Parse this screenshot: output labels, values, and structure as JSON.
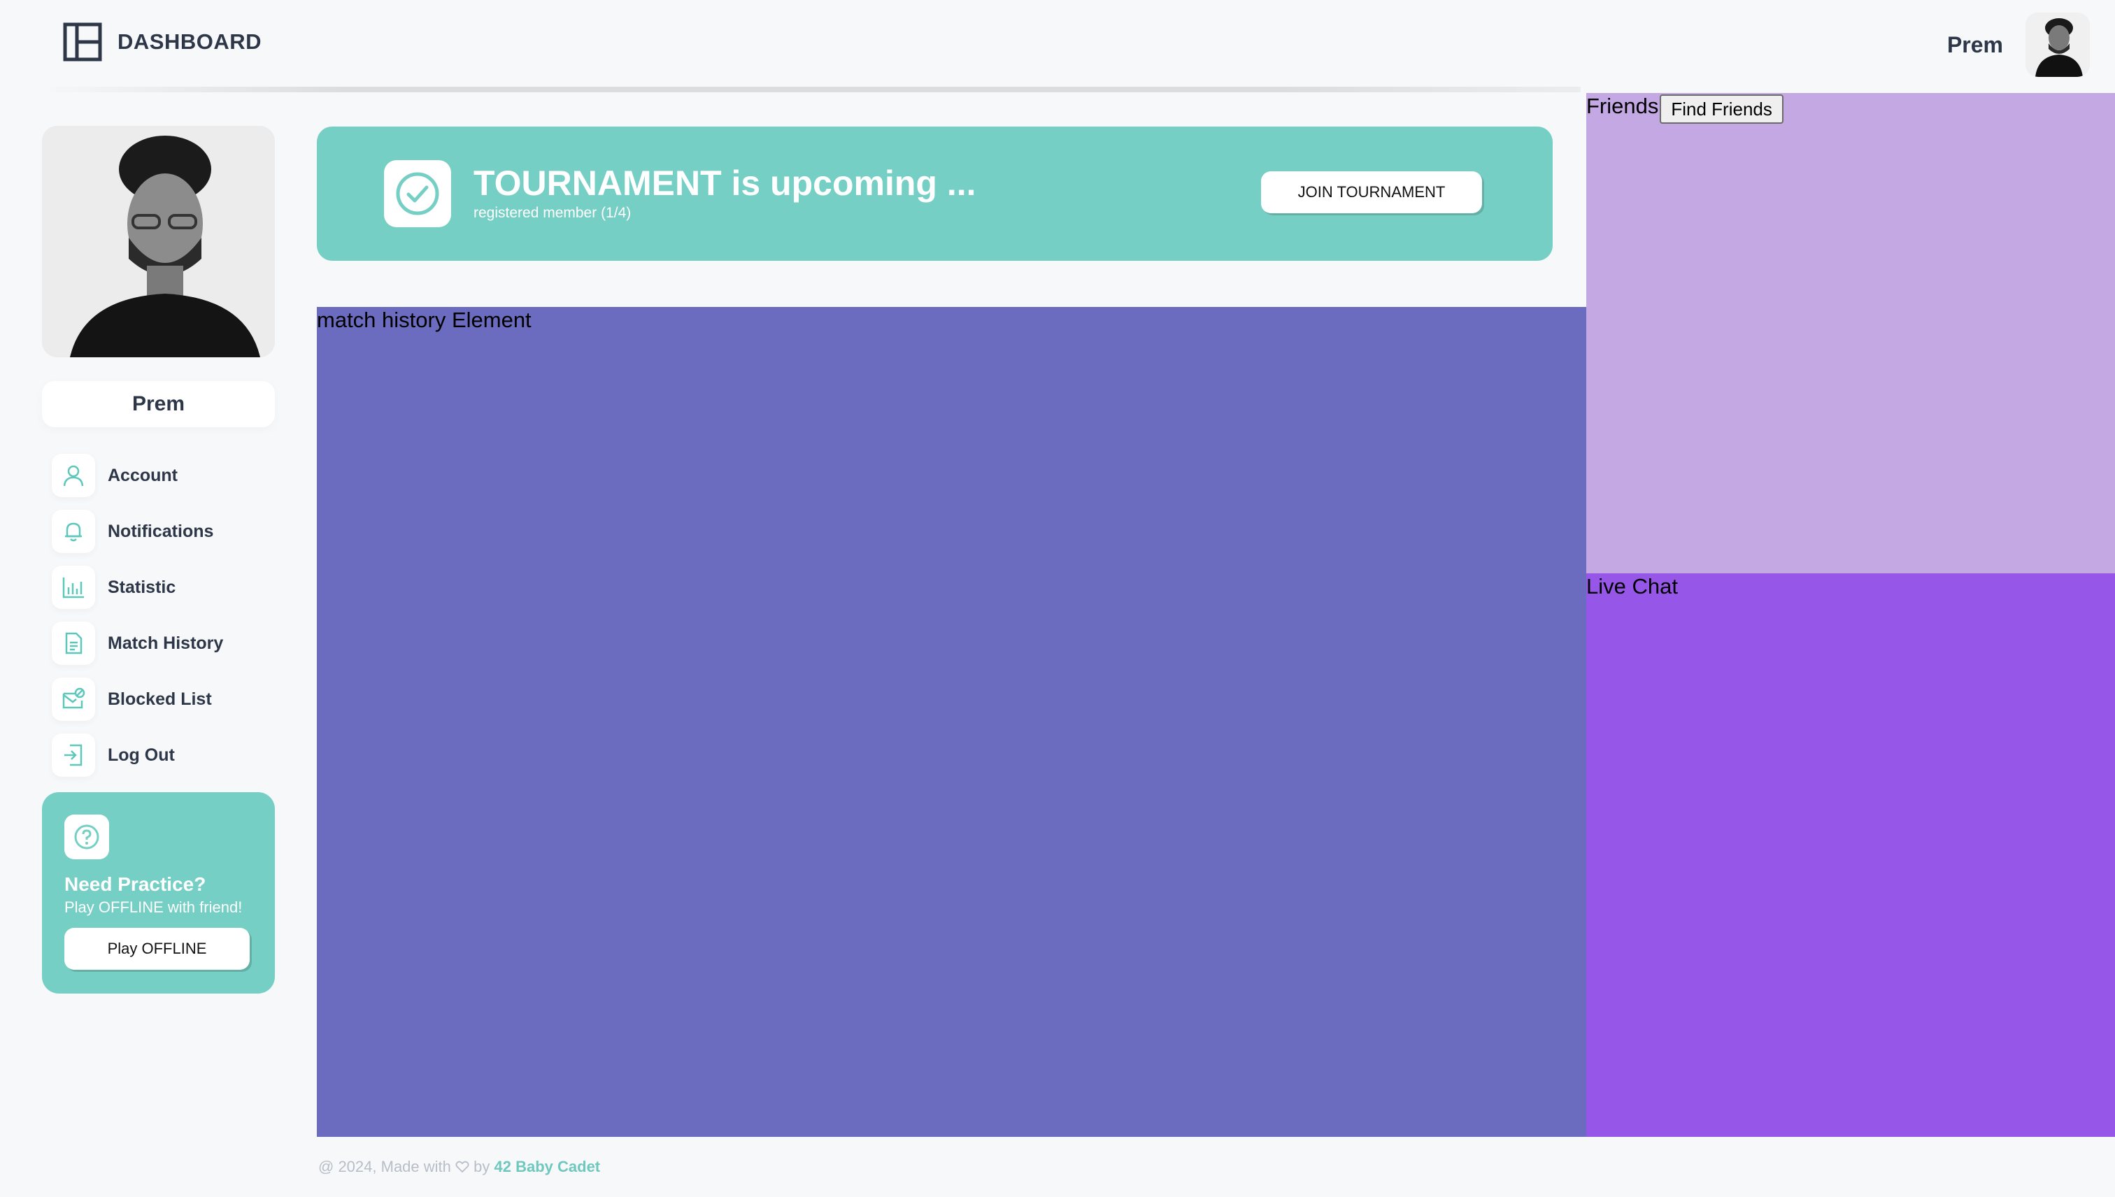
{
  "header": {
    "app_title": "DASHBOARD",
    "user_name": "Prem",
    "icons": {
      "logo": "layout-icon",
      "avatar": "user-avatar"
    }
  },
  "sidebar": {
    "profile_name": "Prem",
    "items": [
      {
        "label": "Account",
        "icon": "user-icon"
      },
      {
        "label": "Notifications",
        "icon": "bell-icon"
      },
      {
        "label": "Statistic",
        "icon": "bar-chart-icon"
      },
      {
        "label": "Match History",
        "icon": "document-icon"
      },
      {
        "label": "Blocked List",
        "icon": "mail-blocked-icon"
      },
      {
        "label": "Log Out",
        "icon": "logout-icon"
      }
    ],
    "practice": {
      "title": "Need Practice?",
      "subtitle": "Play OFFLINE with friend!",
      "button": "Play OFFLINE",
      "icon": "help-circle-icon"
    }
  },
  "tournament": {
    "title": "TOURNAMENT is upcoming ...",
    "subtitle": "registered member (1/4)",
    "button": "JOIN TOURNAMENT",
    "icon": "check-circle-icon"
  },
  "panels": {
    "match_history": "match history Element",
    "friends": "Friends",
    "find_friends_button": "Find Friends",
    "live_chat": "Live Chat"
  },
  "footer": {
    "prefix": "@ 2024, Made with",
    "by": "by",
    "link": "42 Baby Cadet"
  },
  "colors": {
    "accent": "#75cfc4",
    "match_panel": "#6b6bbf",
    "friends_panel": "#c4a8e3",
    "chat_panel": "#9656e8"
  }
}
